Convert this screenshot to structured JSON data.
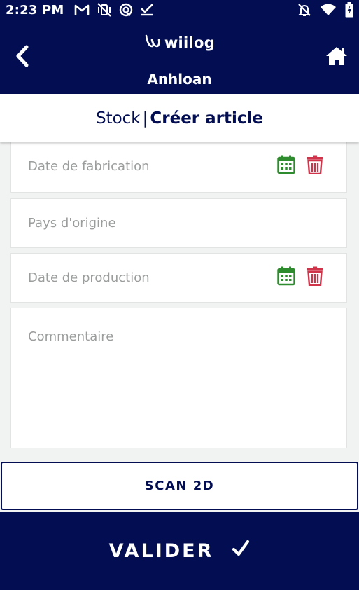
{
  "status_bar": {
    "time": "2:23 PM",
    "icons": [
      "gmail-icon",
      "vibrate-off-icon",
      "sync-icon",
      "checkmark-icon",
      "notifications-off-icon",
      "wifi-icon",
      "battery-charging-icon"
    ]
  },
  "header": {
    "logo_text": "wiilog",
    "store_name": "Anhloan",
    "back_icon": "chevron-left-icon",
    "home_icon": "home-icon"
  },
  "breadcrumb": {
    "parent": "Stock",
    "separator": "|",
    "current": "Créer article"
  },
  "form": {
    "fields": [
      {
        "placeholder": "Date de fabrication",
        "type": "date"
      },
      {
        "placeholder": "Pays d'origine",
        "type": "text"
      },
      {
        "placeholder": "Date de production",
        "type": "date"
      },
      {
        "placeholder": "Commentaire",
        "type": "textarea"
      }
    ]
  },
  "actions": {
    "scan_label": "SCAN 2D",
    "validate_label": "VALIDER",
    "validate_icon": "checkmark-icon"
  },
  "colors": {
    "primary": "#020d52",
    "calendar": "#2e8b2e",
    "delete": "#d0344b",
    "placeholder": "#9b9d9d",
    "background": "#f1f2f2"
  }
}
